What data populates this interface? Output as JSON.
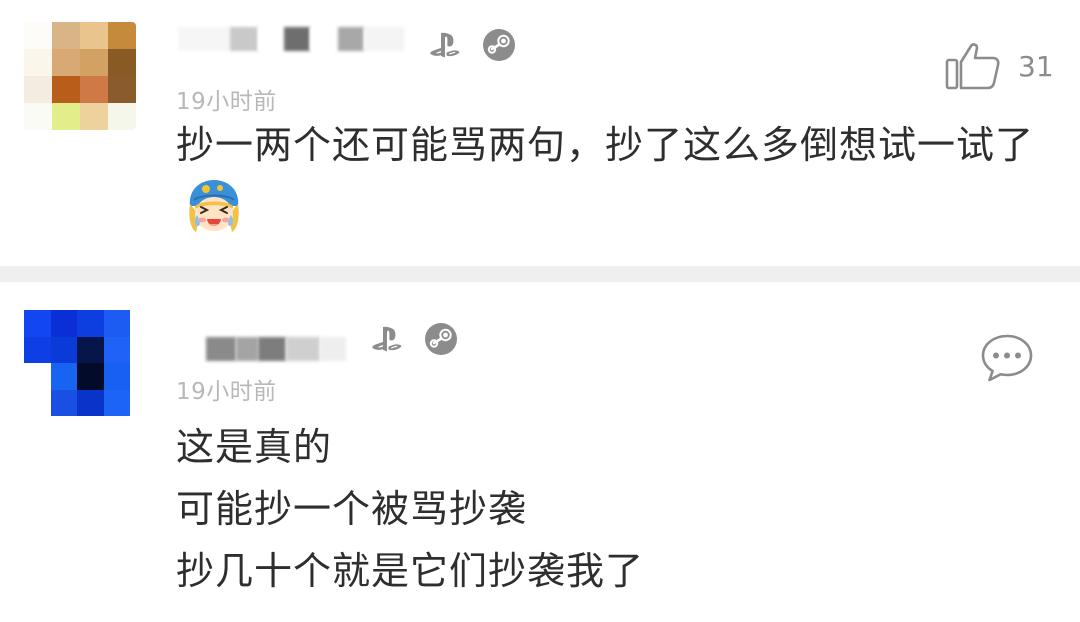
{
  "comments": [
    {
      "time": "19小时前",
      "text": "抄一两个还可能骂两句，抄了这么多倒想试一试了",
      "likes": "31",
      "platform_icons": [
        "playstation-icon",
        "steam-icon"
      ],
      "emoji": "crying-laughing-sticker"
    },
    {
      "time": "19小时前",
      "lines": [
        "这是真的",
        "可能抄一个被骂抄袭",
        "抄几十个就是它们抄袭我了"
      ],
      "platform_icons": [
        "playstation-icon",
        "steam-icon"
      ],
      "action_icon": "comment-bubble-icon"
    }
  ],
  "colors": {
    "divider": "#efefef",
    "time": "#b8b8b8",
    "text": "#2e2e2e",
    "icon_gray": "#8c8c8c"
  }
}
